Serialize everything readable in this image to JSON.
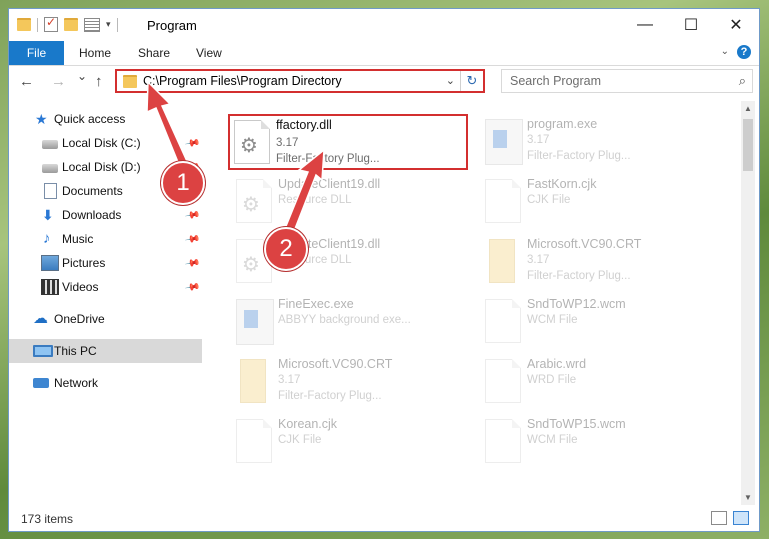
{
  "window": {
    "title": "Program",
    "minimize": "—",
    "maximize": "☐",
    "close": "✕"
  },
  "ribbon": {
    "tabs": [
      "File",
      "Home",
      "Share",
      "View"
    ],
    "help": "?"
  },
  "nav": {
    "back": "←",
    "forward": "→",
    "recent": "⌄",
    "up": "↑",
    "address": "C:\\Program Files\\Program Directory",
    "refresh": "↻",
    "search_placeholder": "Search Program",
    "search_icon": "⌕"
  },
  "sidebar": {
    "items": [
      {
        "label": "Quick access",
        "icon": "star-icon"
      },
      {
        "label": "Local Disk (C:)",
        "icon": "disk-icon",
        "pinned": true
      },
      {
        "label": "Local Disk (D:)",
        "icon": "disk-icon",
        "pinned": true
      },
      {
        "label": "Documents",
        "icon": "documents-icon",
        "pinned": true
      },
      {
        "label": "Downloads",
        "icon": "download-icon",
        "pinned": true
      },
      {
        "label": "Music",
        "icon": "music-icon",
        "pinned": true
      },
      {
        "label": "Pictures",
        "icon": "pictures-icon",
        "pinned": true
      },
      {
        "label": "Videos",
        "icon": "videos-icon",
        "pinned": true
      },
      {
        "label": "OneDrive",
        "icon": "cloud-icon"
      },
      {
        "label": "This PC",
        "icon": "computer-icon",
        "selected": true
      },
      {
        "label": "Network",
        "icon": "network-icon"
      }
    ]
  },
  "files": [
    {
      "name": "ffactory.dll",
      "line2": "3.17",
      "line3": "Filter-Factory Plug...",
      "icon": "settings-file-icon",
      "highlighted": true
    },
    {
      "name": "program.exe",
      "line2": "3.17",
      "line3": "Filter-Factory Plug...",
      "icon": "app-icon"
    },
    {
      "name": "UpdateClient19.dll",
      "line2": "Resource DLL",
      "icon": "settings-file-icon"
    },
    {
      "name": "FastKorn.cjk",
      "line2": "CJK File",
      "icon": "file-icon"
    },
    {
      "name": "UpdateClient19.dll",
      "line2": "Resource DLL",
      "icon": "settings-file-icon"
    },
    {
      "name": "Microsoft.VC90.CRT",
      "line2": "3.17",
      "line3": "Filter-Factory Plug...",
      "icon": "folder-file-icon"
    },
    {
      "name": "FineExec.exe",
      "line2": "ABBYY background exe...",
      "icon": "app-icon"
    },
    {
      "name": "SndToWP12.wcm",
      "line2": "WCM File",
      "icon": "file-icon"
    },
    {
      "name": "Microsoft.VC90.CRT",
      "line2": "3.17",
      "line3": "Filter-Factory Plug...",
      "icon": "folder-file-icon"
    },
    {
      "name": "Arabic.wrd",
      "line2": "WRD File",
      "icon": "file-icon"
    },
    {
      "name": "Korean.cjk",
      "line2": "CJK File",
      "icon": "file-icon"
    },
    {
      "name": "SndToWP15.wcm",
      "line2": "WCM File",
      "icon": "file-icon"
    }
  ],
  "status": {
    "count": "173 items"
  },
  "annotations": {
    "step1": "1",
    "step2": "2"
  },
  "colors": {
    "accent": "#1979ca",
    "highlight": "#d32f2f",
    "badge": "#dc4242"
  }
}
